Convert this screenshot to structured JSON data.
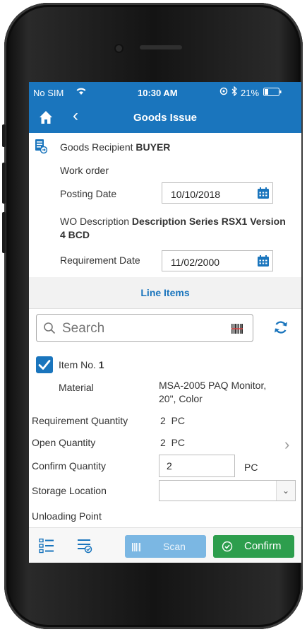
{
  "status": {
    "carrier": "No SIM",
    "time": "10:30 AM",
    "battery": "21%"
  },
  "nav": {
    "title": "Goods Issue"
  },
  "header": {
    "recipient_label": "Goods Recipient",
    "recipient_value": "BUYER",
    "work_order_label": "Work order",
    "posting_date_label": "Posting Date",
    "posting_date_value": "10/10/2018",
    "wo_desc_label": "WO Description",
    "wo_desc_value_1": "Description Series RSX1 Version",
    "wo_desc_value_2": "4 BCD",
    "req_date_label": "Requirement Date",
    "req_date_value": "11/02/2000"
  },
  "line_items": {
    "title": "Line Items"
  },
  "search": {
    "placeholder": "Search"
  },
  "item": {
    "item_no_label": "Item No.",
    "item_no_value": "1",
    "material_label": "Material",
    "material_value_1": "MSA-2005 PAQ Monitor,",
    "material_value_2": "20\", Color",
    "req_qty_label": "Requirement Quantity",
    "req_qty_value": "2",
    "req_qty_unit": "PC",
    "open_qty_label": "Open Quantity",
    "open_qty_value": "2",
    "open_qty_unit": "PC",
    "confirm_qty_label": "Confirm Quantity",
    "confirm_qty_value": "2",
    "confirm_qty_unit": "PC",
    "storage_label": "Storage Location",
    "unloading_label": "Unloading Point"
  },
  "footer": {
    "scan_label": "Scan",
    "confirm_label": "Confirm"
  },
  "colors": {
    "brand": "#1a75bd",
    "confirm": "#2d9e4d",
    "scan": "#7bb7e3"
  }
}
